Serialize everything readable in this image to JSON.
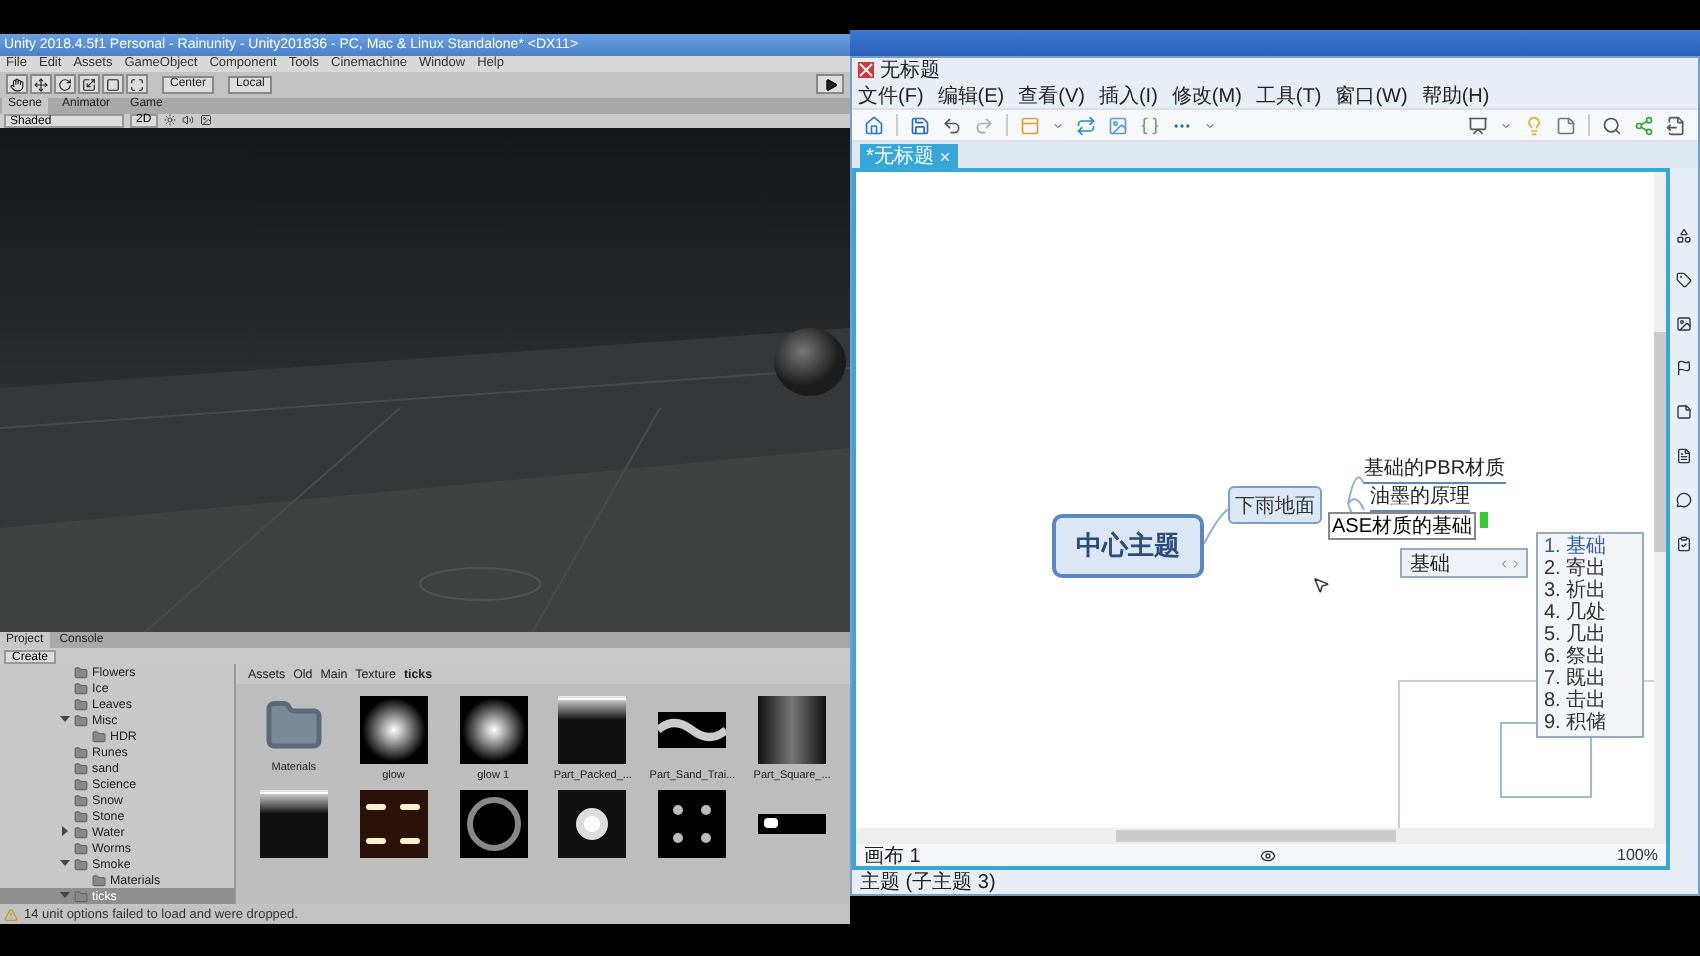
{
  "unity": {
    "title": "Unity 2018.4.5f1 Personal - Rainunity - Unity201836 - PC, Mac & Linux Standalone* <DX11>",
    "menu": [
      "File",
      "Edit",
      "Assets",
      "GameObject",
      "Component",
      "Tools",
      "Cinemachine",
      "Window",
      "Help"
    ],
    "pivot": "Center",
    "space": "Local",
    "scene_tabs": [
      {
        "label": "Scene",
        "selected": true
      },
      {
        "label": "Animator",
        "selected": false
      },
      {
        "label": "Game",
        "selected": false
      }
    ],
    "shading": "Shaded",
    "mode": "2D",
    "project_tabs": [
      {
        "label": "Project",
        "selected": true
      },
      {
        "label": "Console",
        "selected": false
      }
    ],
    "create": "Create",
    "tree": [
      {
        "label": "Flowers",
        "selected": false
      },
      {
        "label": "Ice",
        "selected": false
      },
      {
        "label": "Leaves",
        "selected": false
      },
      {
        "label": "Misc",
        "selected": false,
        "expanded": true,
        "children": [
          {
            "label": "HDR",
            "selected": false
          }
        ]
      },
      {
        "label": "Runes",
        "selected": false
      },
      {
        "label": "sand",
        "selected": false
      },
      {
        "label": "Science",
        "selected": false
      },
      {
        "label": "Snow",
        "selected": false
      },
      {
        "label": "Stone",
        "selected": false
      },
      {
        "label": "Water",
        "selected": false,
        "expanded": false
      },
      {
        "label": "Worms",
        "selected": false
      },
      {
        "label": "Smoke",
        "selected": false,
        "expanded": true,
        "children": [
          {
            "label": "Materials",
            "selected": false
          }
        ]
      },
      {
        "label": "ticks",
        "selected": true,
        "expanded": true
      }
    ],
    "breadcrumb": [
      "Assets",
      "Old",
      "Main",
      "Texture",
      "ticks"
    ],
    "assets": [
      {
        "kind": "folder",
        "label": "Materials"
      },
      {
        "kind": "glow",
        "label": "glow"
      },
      {
        "kind": "glow",
        "label": "glow 1"
      },
      {
        "kind": "band",
        "label": "Part_Packed_..."
      },
      {
        "kind": "wave",
        "label": "Part_Sand_Trai..."
      },
      {
        "kind": "fade",
        "label": "Part_Square_..."
      },
      {
        "kind": "band"
      },
      {
        "kind": "streaks"
      },
      {
        "kind": "ring"
      },
      {
        "kind": "flake"
      },
      {
        "kind": "dots"
      },
      {
        "kind": "bar"
      }
    ],
    "status": "14 unit options failed to load and were dropped."
  },
  "xmind": {
    "title": "无标题",
    "menu": [
      "文件(F)",
      "编辑(E)",
      "查看(V)",
      "插入(I)",
      "修改(M)",
      "工具(T)",
      "窗口(W)",
      "帮助(H)"
    ],
    "tab": "*无标题",
    "central": "中心主题",
    "main_topic": "下雨地面",
    "subtopics": [
      "基础的PBR材质",
      "油墨的原理"
    ],
    "editing": "ASE材质的基础",
    "ime": {
      "composition": "基础",
      "candidates": [
        {
          "label": "1. 基础",
          "selected": true
        },
        {
          "label": "2. 寄出",
          "selected": false
        },
        {
          "label": "3. 祈出",
          "selected": false
        },
        {
          "label": "4. 几处",
          "selected": false
        },
        {
          "label": "5. 几出",
          "selected": false
        },
        {
          "label": "6. 祭出",
          "selected": false
        },
        {
          "label": "7. 既出",
          "selected": false
        },
        {
          "label": "8. 击出",
          "selected": false
        },
        {
          "label": "9. 积储",
          "selected": false
        }
      ]
    },
    "sheet": "画布 1",
    "zoom": "100%",
    "status": "主题 (子主题 3)"
  }
}
